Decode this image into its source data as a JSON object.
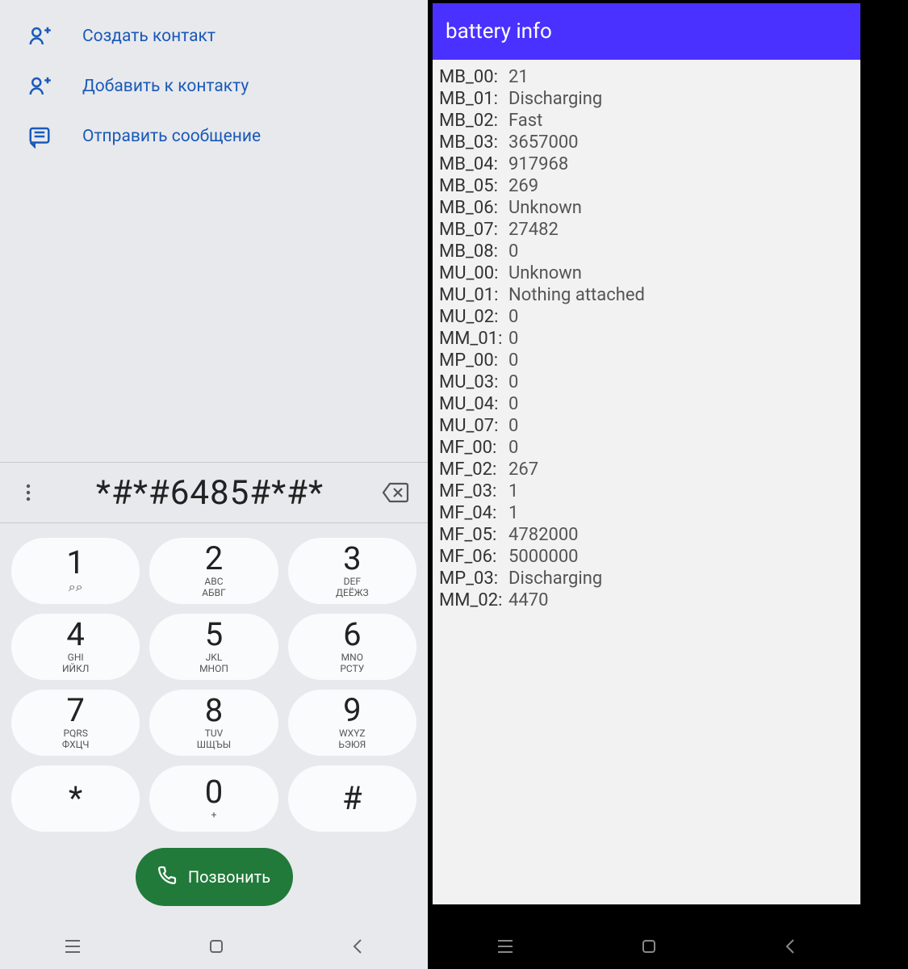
{
  "left": {
    "actions": [
      {
        "label": "Создать контакт",
        "icon": "person-add-icon"
      },
      {
        "label": "Добавить к контакту",
        "icon": "person-add-icon"
      },
      {
        "label": "Отправить сообщение",
        "icon": "message-icon"
      }
    ],
    "dialed": "*#*#6485#*#*",
    "keys": [
      {
        "digit": "1",
        "sub1": "",
        "sub2": ""
      },
      {
        "digit": "2",
        "sub1": "ABC",
        "sub2": "АБВГ"
      },
      {
        "digit": "3",
        "sub1": "DEF",
        "sub2": "ДЕЁЖЗ"
      },
      {
        "digit": "4",
        "sub1": "GHI",
        "sub2": "ИЙКЛ"
      },
      {
        "digit": "5",
        "sub1": "JKL",
        "sub2": "МНОП"
      },
      {
        "digit": "6",
        "sub1": "MNO",
        "sub2": "РСТУ"
      },
      {
        "digit": "7",
        "sub1": "PQRS",
        "sub2": "ФХЦЧ"
      },
      {
        "digit": "8",
        "sub1": "TUV",
        "sub2": "ШЩЪЫ"
      },
      {
        "digit": "9",
        "sub1": "WXYZ",
        "sub2": "ЬЭЮЯ"
      },
      {
        "digit": "*",
        "sub1": "",
        "sub2": ""
      },
      {
        "digit": "0",
        "sub1": "+",
        "sub2": ""
      },
      {
        "digit": "#",
        "sub1": "",
        "sub2": ""
      }
    ],
    "call_label": "Позвонить"
  },
  "right": {
    "title": "battery info",
    "rows": [
      {
        "key": "MB_00:",
        "val": "21"
      },
      {
        "key": "MB_01:",
        "val": "Discharging"
      },
      {
        "key": "MB_02:",
        "val": "Fast"
      },
      {
        "key": "MB_03:",
        "val": "3657000"
      },
      {
        "key": "MB_04:",
        "val": "917968"
      },
      {
        "key": "MB_05:",
        "val": "269"
      },
      {
        "key": "MB_06:",
        "val": "Unknown"
      },
      {
        "key": "MB_07:",
        "val": "27482"
      },
      {
        "key": "MB_08:",
        "val": "0"
      },
      {
        "key": "MU_00:",
        "val": "Unknown"
      },
      {
        "key": "MU_01:",
        "val": "Nothing attached"
      },
      {
        "key": "MU_02:",
        "val": "0"
      },
      {
        "key": "MM_01:",
        "val": "0"
      },
      {
        "key": "MP_00:",
        "val": "0"
      },
      {
        "key": "MU_03:",
        "val": "0"
      },
      {
        "key": "MU_04:",
        "val": "0"
      },
      {
        "key": "MU_07:",
        "val": "0"
      },
      {
        "key": "MF_00:",
        "val": "0"
      },
      {
        "key": "MF_02:",
        "val": "267"
      },
      {
        "key": "MF_03:",
        "val": "1"
      },
      {
        "key": "MF_04:",
        "val": "1"
      },
      {
        "key": "MF_05:",
        "val": "4782000"
      },
      {
        "key": "MF_06:",
        "val": "5000000"
      },
      {
        "key": "MP_03:",
        "val": "Discharging"
      },
      {
        "key": "MM_02:",
        "val": "4470"
      }
    ]
  }
}
